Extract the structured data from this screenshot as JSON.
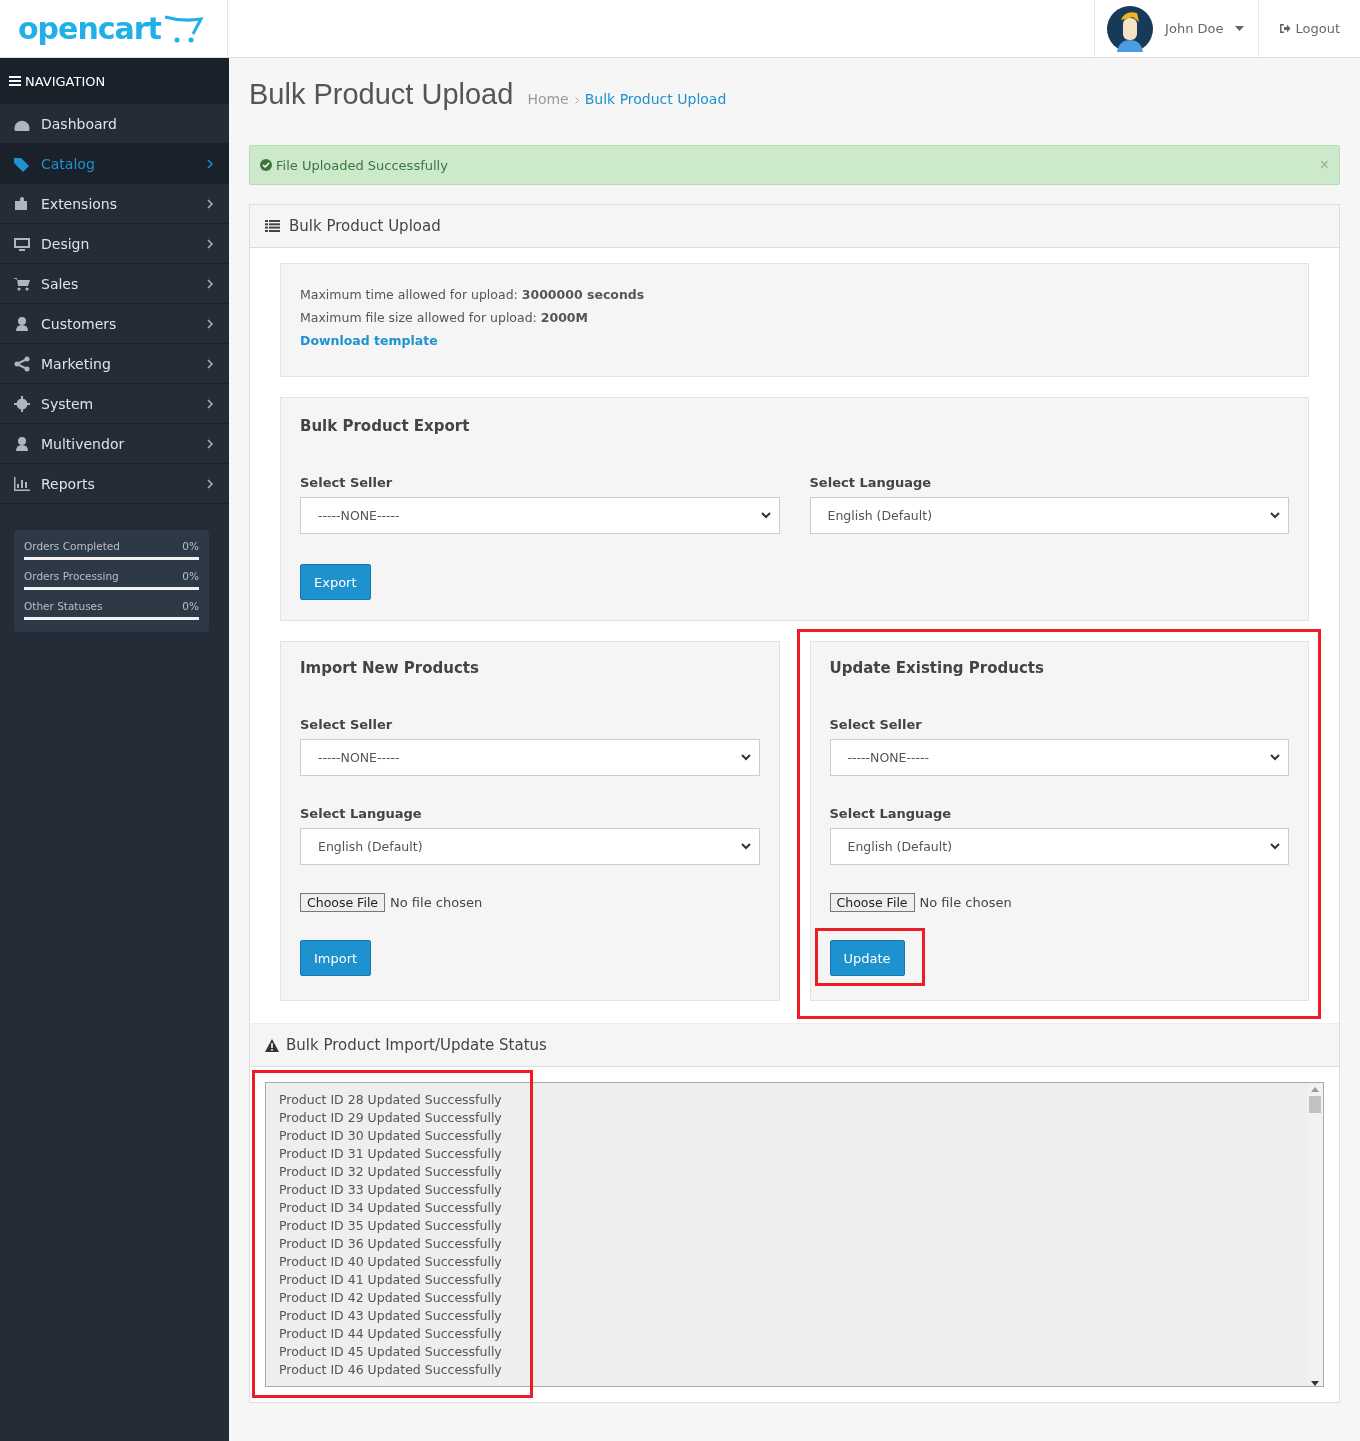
{
  "header": {
    "logo": "opencart",
    "user": "John Doe",
    "logout": "Logout"
  },
  "sidebar": {
    "heading": "NAVIGATION",
    "items": [
      {
        "label": "Dashboard",
        "expandable": false,
        "selected": false
      },
      {
        "label": "Catalog",
        "expandable": true,
        "selected": true
      },
      {
        "label": "Extensions",
        "expandable": true,
        "selected": false
      },
      {
        "label": "Design",
        "expandable": true,
        "selected": false
      },
      {
        "label": "Sales",
        "expandable": true,
        "selected": false
      },
      {
        "label": "Customers",
        "expandable": true,
        "selected": false
      },
      {
        "label": "Marketing",
        "expandable": true,
        "selected": false
      },
      {
        "label": "System",
        "expandable": true,
        "selected": false
      },
      {
        "label": "Multivendor",
        "expandable": true,
        "selected": false
      },
      {
        "label": "Reports",
        "expandable": true,
        "selected": false
      }
    ],
    "stats": [
      {
        "label": "Orders Completed",
        "value": "0%",
        "level": 0
      },
      {
        "label": "Orders Processing",
        "value": "0%",
        "level": 0
      },
      {
        "label": "Other Statuses",
        "value": "0%",
        "level": 0
      }
    ]
  },
  "page": {
    "title": "Bulk Product Upload",
    "breadcrumb": [
      "Home",
      "Bulk Product Upload"
    ]
  },
  "alert": {
    "text": "File Uploaded Successfully",
    "close": "×"
  },
  "panel": {
    "title": "Bulk Product Upload",
    "info": {
      "lines": [
        "Maximum time allowed for upload: **3000000  seconds**",
        "Maximum file size allowed for upload: **2000M**"
      ],
      "link": "Download template"
    },
    "export": {
      "title": "Bulk Product Export",
      "fields": [
        {
          "label": "Select Seller",
          "value": "-----NONE-----"
        },
        {
          "label": "Select Language",
          "value": "English (Default)"
        }
      ],
      "button": "Export"
    },
    "sections": [
      {
        "title": "Import New Products",
        "highlighted": false,
        "fields": [
          {
            "label": "Select Seller",
            "value": "-----NONE-----"
          },
          {
            "label": "Select Language",
            "value": "English (Default)"
          }
        ],
        "file_button": "Choose File",
        "file_status": "No file chosen",
        "button": "Import",
        "button_highlighted": false
      },
      {
        "title": "Update Existing Products",
        "highlighted": true,
        "fields": [
          {
            "label": "Select Seller",
            "value": "-----NONE-----"
          },
          {
            "label": "Select Language",
            "value": "English (Default)"
          }
        ],
        "file_button": "Choose File",
        "file_status": "No file chosen",
        "button": "Update",
        "button_highlighted": true
      }
    ],
    "status": {
      "title": "Bulk Product Import/Update Status",
      "highlighted": true,
      "lines": [
        "Product ID 28 Updated Successfully",
        "Product ID 29 Updated Successfully",
        "Product ID 30 Updated Successfully",
        "Product ID 31 Updated Successfully",
        "Product ID 32 Updated Successfully",
        "Product ID 33 Updated Successfully",
        "Product ID 34 Updated Successfully",
        "Product ID 35 Updated Successfully",
        "Product ID 36 Updated Successfully",
        "Product ID 40 Updated Successfully",
        "Product ID 41 Updated Successfully",
        "Product ID 42 Updated Successfully",
        "Product ID 43 Updated Successfully",
        "Product ID 44 Updated Successfully",
        "Product ID 45 Updated Successfully",
        "Product ID 46 Updated Successfully"
      ]
    }
  }
}
